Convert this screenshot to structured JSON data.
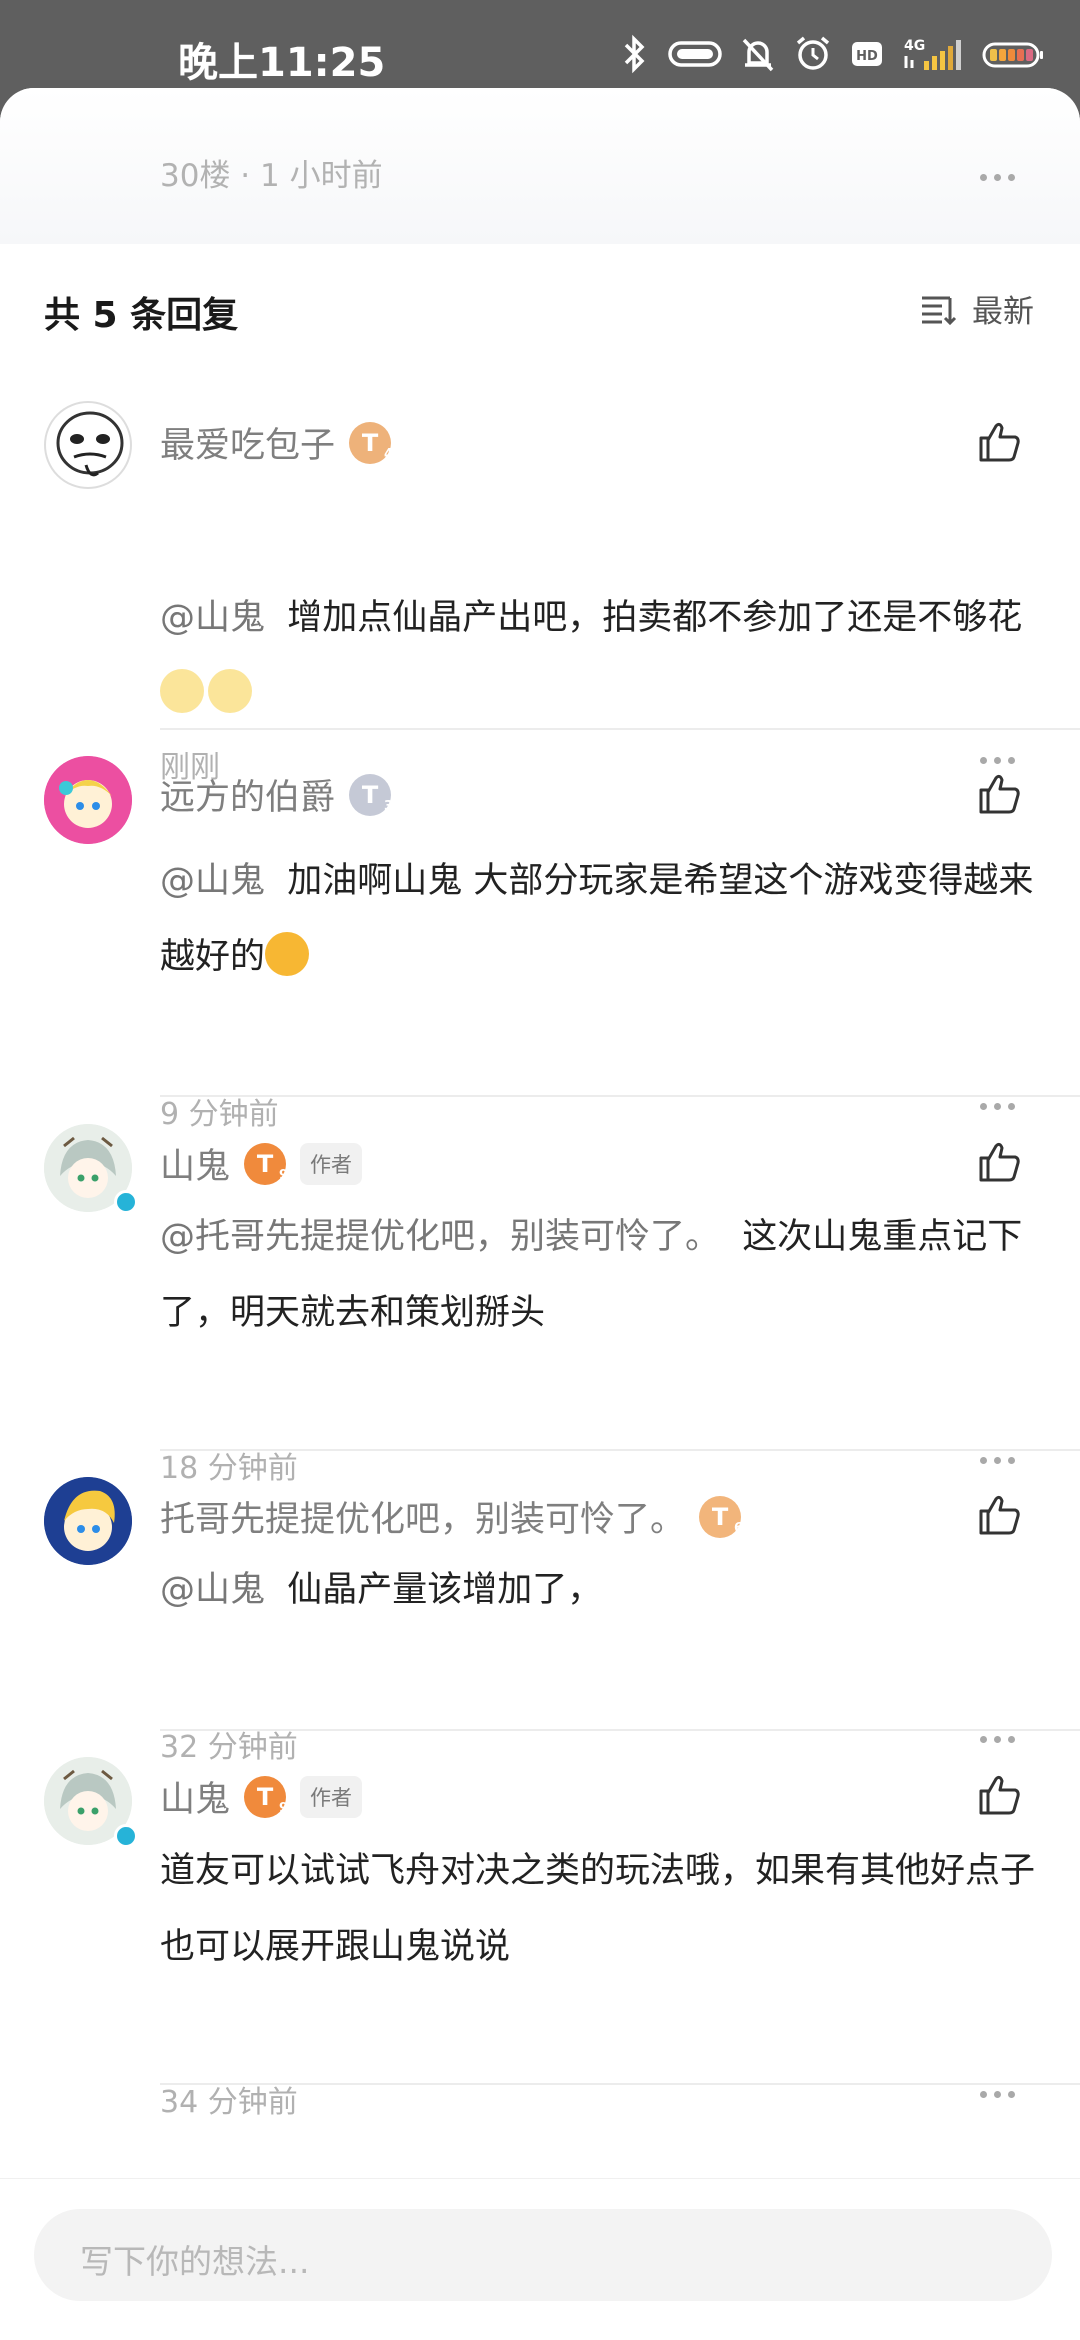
{
  "status_bar": {
    "time": "晚上11:25",
    "network": "4G",
    "hd": "HD"
  },
  "floor": {
    "meta": "30楼 · 1 小时前"
  },
  "replies_header": {
    "count_label": "共 5 条回复",
    "sort_label": "最新"
  },
  "comments": [
    {
      "name": "最爱吃包子",
      "level": "4",
      "mention": "@山鬼",
      "text": "增加点仙晶产出吧，拍卖都不参加了还是不够花",
      "time": "刚刚"
    },
    {
      "name": "远方的伯爵",
      "level": "3",
      "mention": "@山鬼",
      "text": "加油啊山鬼 大部分玩家是希望这个游戏变得越来越好的",
      "time": "9 分钟前"
    },
    {
      "name": "山鬼",
      "level": "9",
      "tag": "作者",
      "mention": "@托哥先提提优化吧，别装可怜了。",
      "text": "这次山鬼重点记下了，明天就去和策划掰头",
      "time": "18 分钟前"
    },
    {
      "name": "托哥先提提优化吧，别装可怜了。",
      "level": "6",
      "mention": "@山鬼",
      "text": "仙晶产量该增加了，",
      "time": "32 分钟前"
    },
    {
      "name": "山鬼",
      "level": "9",
      "tag": "作者",
      "text": "道友可以试试飞舟对决之类的玩法哦，如果有其他好点子也可以展开跟山鬼说说",
      "time": "34 分钟前"
    }
  ],
  "input": {
    "placeholder": "写下你的想法..."
  }
}
